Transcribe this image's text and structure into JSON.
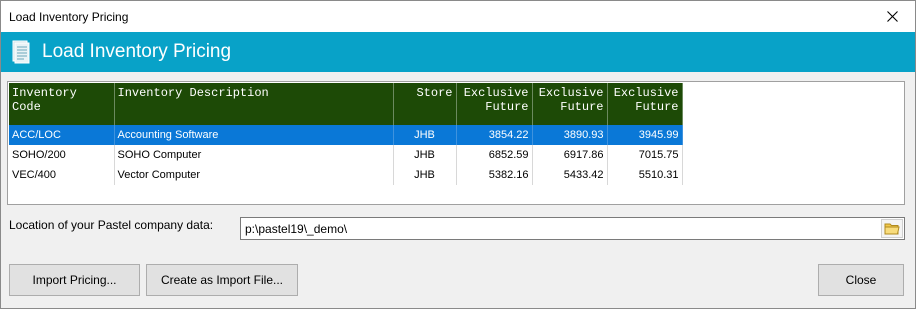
{
  "window": {
    "title": "Load Inventory Pricing",
    "close_glyph": "✕"
  },
  "banner": {
    "title": "Load Inventory Pricing",
    "icon": "document-icon"
  },
  "grid": {
    "columns": [
      "Inventory Code",
      "Inventory Description",
      "Store",
      "Exclusive\nFuture",
      "Exclusive\nFuture",
      "Exclusive\nFuture"
    ],
    "rows": [
      {
        "code": "ACC/LOC",
        "description": "Accounting Software",
        "store": "JHB",
        "p1": "3854.22",
        "p2": "3890.93",
        "p3": "3945.99",
        "selected": true
      },
      {
        "code": "SOHO/200",
        "description": "SOHO Computer",
        "store": "JHB",
        "p1": "6852.59",
        "p2": "6917.86",
        "p3": "7015.75",
        "selected": false
      },
      {
        "code": "VEC/400",
        "description": "Vector Computer",
        "store": "JHB",
        "p1": "5382.16",
        "p2": "5433.42",
        "p3": "5510.31",
        "selected": false
      }
    ],
    "header_color": "#1d4a06",
    "selection_color": "#0a78d7"
  },
  "location": {
    "label": "Location of your Pastel company data:",
    "value": "p:\\pastel19\\_demo\\",
    "browse_icon": "folder-icon"
  },
  "buttons": {
    "import": "Import Pricing...",
    "create": "Create as Import File...",
    "close": "Close"
  },
  "colors": {
    "banner": "#08a2c8"
  }
}
